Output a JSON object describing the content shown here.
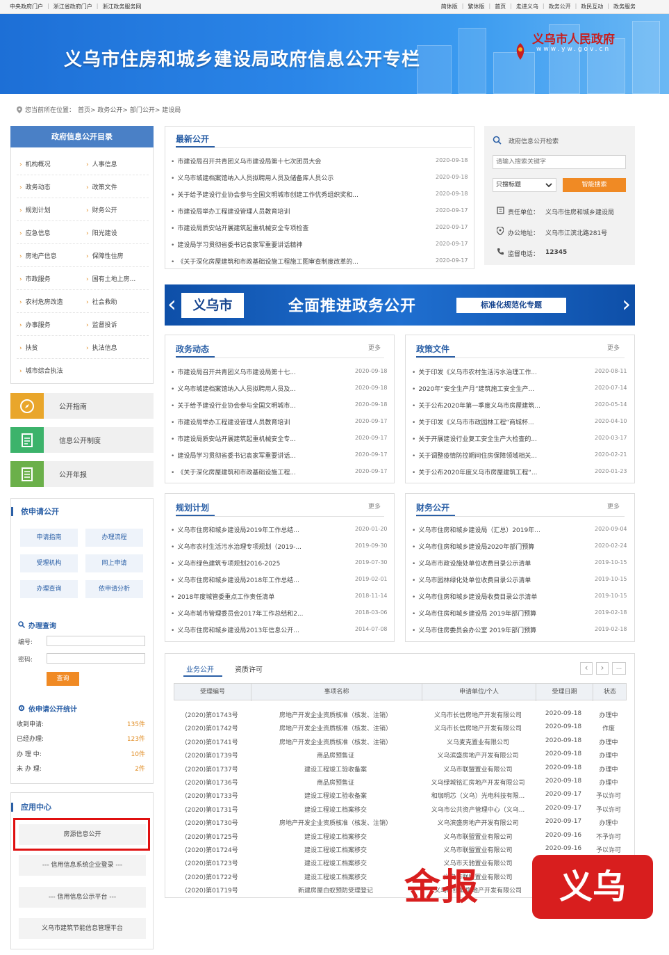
{
  "topbar": {
    "left": [
      "中央政府门户",
      "浙江省政府门户",
      "浙江政务服务网"
    ],
    "right": [
      "简体版",
      "繁体版",
      "首页",
      "走进义乌",
      "政务公开",
      "政民互动",
      "政务服务"
    ]
  },
  "banner": {
    "title": "义乌市住房和城乡建设局政府信息公开专栏",
    "logo": "义乌市人民政府",
    "logo_url": "www.yw.gov.cn"
  },
  "breadcrumb": {
    "prefix": "您当前所在位置：",
    "path": "首页> 政务公开> 部门公开> 建设局"
  },
  "directory": {
    "title": "政府信息公开目录",
    "items": [
      [
        "机构概况",
        "人事信息"
      ],
      [
        "政务动态",
        "政策文件"
      ],
      [
        "规划计划",
        "财务公开"
      ],
      [
        "应急信息",
        "阳光建设"
      ],
      [
        "房地产信息",
        "保障性住房"
      ],
      [
        "市政服务",
        "国有土地上房..."
      ],
      [
        "农村危房改造",
        "社会救助"
      ],
      [
        "办事服务",
        "监督投诉"
      ],
      [
        "扶贫",
        "执法信息"
      ],
      [
        "城市综合执法",
        ""
      ]
    ]
  },
  "tiles": [
    {
      "label": "公开指南",
      "icon": "compass-icon",
      "color": "#e9a62b"
    },
    {
      "label": "信息公开制度",
      "icon": "document-icon",
      "color": "#3cb36b"
    },
    {
      "label": "公开年报",
      "icon": "report-icon",
      "color": "#6bb04a"
    }
  ],
  "apply": {
    "title": "依申请公开",
    "buttons": [
      "申请指南",
      "办理流程",
      "受理机构",
      "网上申请",
      "办理查询",
      "依申请分析"
    ],
    "query_title": "办理查询",
    "num_label": "编号:",
    "pwd_label": "密码:",
    "query_btn": "查询",
    "stats_title": "依申请公开统计",
    "stats": [
      {
        "label": "收到申请:",
        "value": "135件"
      },
      {
        "label": "已经办理:",
        "value": "123件"
      },
      {
        "label": "办 理 中:",
        "value": "10件"
      },
      {
        "label": "未 办 理:",
        "value": "2件"
      }
    ]
  },
  "app_center": {
    "title": "应用中心",
    "items": [
      "房源信息公开",
      "--- 信用信息系统企业登录 ---",
      "--- 信用信息公示平台 ---",
      "义乌市建筑节能信息管理平台"
    ]
  },
  "latest": {
    "title": "最新公开",
    "items": [
      {
        "text": "市建设局召开共青团义乌市建设局第十七次团员大会",
        "date": "2020-09-18"
      },
      {
        "text": "义乌市城建档案馆纳入人员拟聘用人员及储备库人员公示",
        "date": "2020-09-18"
      },
      {
        "text": "关于给予建设行业协会参与全国文明城市创建工作优秀组织奖和...",
        "date": "2020-09-18"
      },
      {
        "text": "市建设局举办工程建设管理人员教育培训",
        "date": "2020-09-17"
      },
      {
        "text": "市建设局质安站开展建筑起重机械安全专项检查",
        "date": "2020-09-17"
      },
      {
        "text": "建设局学习贯彻省委书记袁家军重要讲话精神",
        "date": "2020-09-17"
      },
      {
        "text": "《关于深化房屋建筑和市政基础设施工程施工图审查制度改革的...",
        "date": "2020-09-17"
      }
    ]
  },
  "search": {
    "title": "政府信息公开检索",
    "placeholder": "请输入搜索关键字",
    "select": "只搜标题",
    "button": "智能搜索",
    "unit_label": "责任单位：",
    "unit": "义乌市住房和城乡建设局",
    "addr_label": "办公地址：",
    "addr": "义乌市江滨北路281号",
    "phone_label": "监督电话：",
    "phone": "12345"
  },
  "promo": {
    "city": "义乌市",
    "main": "全面推进政务公开",
    "tag": "标准化规范化专题"
  },
  "sections": {
    "more": "更多",
    "dongtai": {
      "title": "政务动态",
      "items": [
        {
          "text": "市建设局召开共青团义乌市建设局第十七...",
          "date": "2020-09-18"
        },
        {
          "text": "义乌市城建档案馆纳入人员拟聘用人员及...",
          "date": "2020-09-18"
        },
        {
          "text": "关于给予建设行业协会参与全国文明城市...",
          "date": "2020-09-18"
        },
        {
          "text": "市建设局举办工程建设管理人员教育培训",
          "date": "2020-09-17"
        },
        {
          "text": "市建设局质安站开展建筑起重机械安全专...",
          "date": "2020-09-17"
        },
        {
          "text": "建设局学习贯彻省委书记袁家军重要讲话...",
          "date": "2020-09-17"
        },
        {
          "text": "《关于深化房屋建筑和市政基础设施工程...",
          "date": "2020-09-17"
        }
      ]
    },
    "zhengce": {
      "title": "政策文件",
      "items": [
        {
          "text": "关于印发《义乌市农村生活污水治理工作...",
          "date": "2020-08-11"
        },
        {
          "text": "2020年“安全生产月”建筑施工安全生产...",
          "date": "2020-07-14"
        },
        {
          "text": "关于公布2020年第一季度义乌市房屋建筑...",
          "date": "2020-05-14"
        },
        {
          "text": "关于印发《义乌市市政园林工程“商城杯...",
          "date": "2020-04-10"
        },
        {
          "text": "关于开展建设行业复工安全生产大检查的...",
          "date": "2020-03-17"
        },
        {
          "text": "关于调整疫情防控期间住房保障领域相关...",
          "date": "2020-02-21"
        },
        {
          "text": "关于公布2020年度义乌市房屋建筑工程“...",
          "date": "2020-01-23"
        }
      ]
    },
    "guihua": {
      "title": "规划计划",
      "items": [
        {
          "text": "义乌市住房和城乡建设局2019年工作总结...",
          "date": "2020-01-20"
        },
        {
          "text": "义乌市农村生活污水治理专项规划（2019-...",
          "date": "2019-09-30"
        },
        {
          "text": "义乌市绿色建筑专项规划2016-2025",
          "date": "2019-07-30"
        },
        {
          "text": "义乌市住房和城乡建设局2018年工作总结...",
          "date": "2019-02-01"
        },
        {
          "text": "2018年度城管委重点工作责任清单",
          "date": "2018-11-14"
        },
        {
          "text": "义乌市城市管理委员会2017年工作总结和2...",
          "date": "2018-03-06"
        },
        {
          "text": "义乌市住房和城乡建设局2013年信息公开...",
          "date": "2014-07-08"
        }
      ]
    },
    "caiwu": {
      "title": "财务公开",
      "items": [
        {
          "text": "义乌市住房和城乡建设局（汇总）2019年...",
          "date": "2020-09-04"
        },
        {
          "text": "义乌市住房和城乡建设局2020年部门预算",
          "date": "2020-02-24"
        },
        {
          "text": "义乌市市政设施处单位收费目录公示清单",
          "date": "2019-10-15"
        },
        {
          "text": "义乌市园林绿化处单位收费目录公示清单",
          "date": "2019-10-15"
        },
        {
          "text": "义乌市住房和城乡建设局收费目录公示清单",
          "date": "2019-10-15"
        },
        {
          "text": "义乌市住房和城乡建设局 2019年部门预算",
          "date": "2019-02-18"
        },
        {
          "text": "义乌市住房委员会办公室 2019年部门预算",
          "date": "2019-02-18"
        }
      ]
    }
  },
  "business": {
    "tabs": [
      "业务公开",
      "资质许可"
    ],
    "pager": [
      "‹",
      "›",
      "..."
    ],
    "headers": [
      "受理编号",
      "事项名称",
      "申请单位/个人",
      "受理日期",
      "状态"
    ],
    "rows": [
      [
        "(2020)第01743号",
        "房地产开发企业资质核准（核发、注销）",
        "义乌市长信房地产开发有限公司",
        "2020-09-18",
        "办理中"
      ],
      [
        "(2020)第01742号",
        "房地产开发企业资质核准（核发、注销）",
        "义乌市长信房地产开发有限公司",
        "2020-09-18",
        "作废"
      ],
      [
        "(2020)第01741号",
        "房地产开发企业资质核准（核发、注销）",
        "义乌麦克置业有限公司",
        "2020-09-18",
        "办理中"
      ],
      [
        "(2020)第01739号",
        "商品房预售证",
        "义乌滨盛房地产开发有限公司",
        "2020-09-18",
        "办理中"
      ],
      [
        "(2020)第01737号",
        "建设工程竣工验收备案",
        "义乌市联盟置业有限公司",
        "2020-09-18",
        "办理中"
      ],
      [
        "(2020)第01736号",
        "商品房预售证",
        "义乌绿城铭汇房地产开发有限公司",
        "2020-09-18",
        "办理中"
      ],
      [
        "(2020)第01733号",
        "建设工程竣工验收备案",
        "和珈明芯（义乌）光电科技有限...",
        "2020-09-17",
        "予以许可"
      ],
      [
        "(2020)第01731号",
        "建设工程竣工档案移交",
        "义乌市公共资产管理中心（义乌...",
        "2020-09-17",
        "予以许可"
      ],
      [
        "(2020)第01730号",
        "房地产开发企业资质核准（核发、注销）",
        "义乌滨盛房地产开发有限公司",
        "2020-09-17",
        "办理中"
      ],
      [
        "(2020)第01725号",
        "建设工程竣工档案移交",
        "义乌市联盟置业有限公司",
        "2020-09-16",
        "不予许可"
      ],
      [
        "(2020)第01724号",
        "建设工程竣工档案移交",
        "义乌市联盟置业有限公司",
        "2020-09-16",
        "予以许可"
      ],
      [
        "(2020)第01723号",
        "建设工程竣工档案移交",
        "义乌市天驰置业有限公司",
        "",
        ""
      ],
      [
        "(2020)第01722号",
        "建设工程竣工档案移交",
        "义乌市联盟置业有限公司",
        "",
        ""
      ],
      [
        "(2020)第01719号",
        "新建房屋白蚁预防受理登记",
        "义乌市绿城房地产开发有限公司",
        "",
        ""
      ]
    ]
  },
  "watermark": {
    "left": "金报",
    "right": "义乌"
  },
  "colors": {
    "brand_blue": "#2a5fa6",
    "accent_orange": "#f08a24",
    "highlight_red": "#e01010"
  }
}
